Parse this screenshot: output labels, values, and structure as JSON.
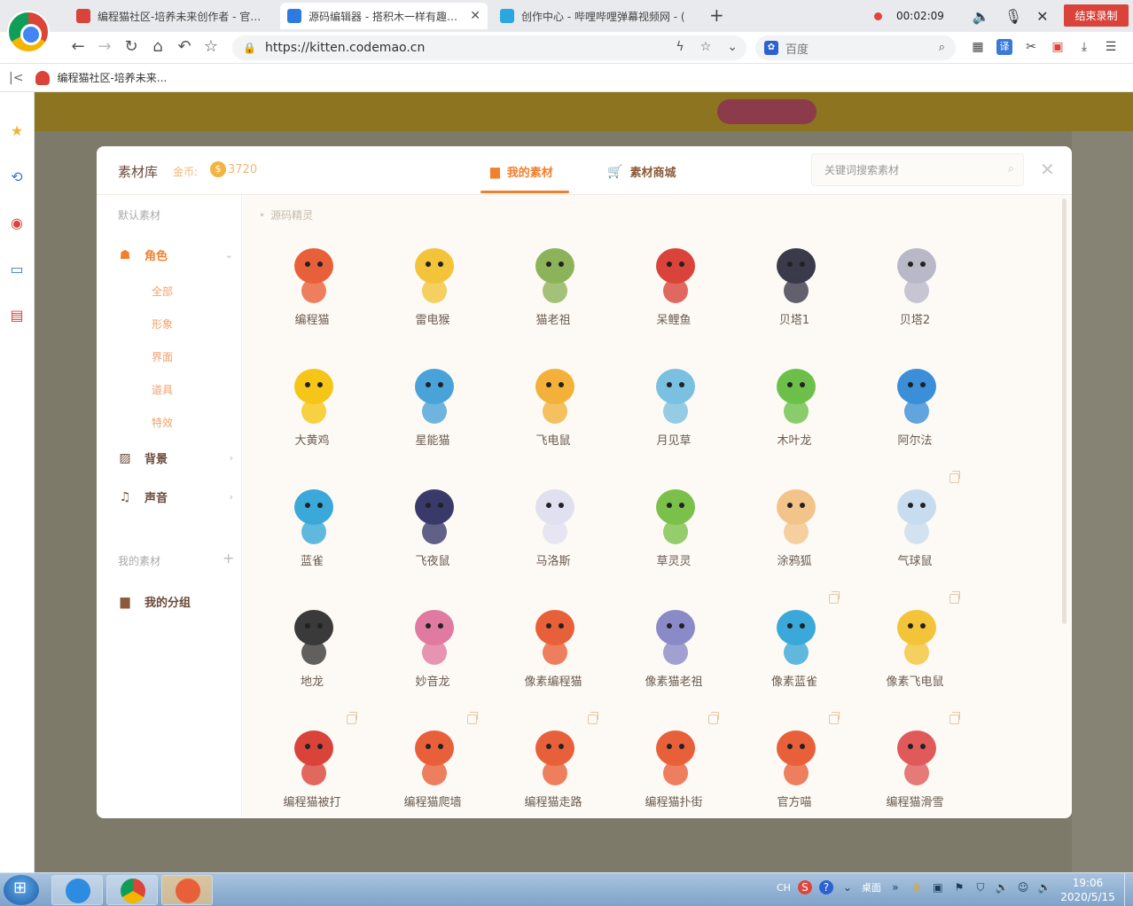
{
  "browser": {
    "tabs": [
      {
        "label": "编程猫社区-培养未来创作者 - 官方社",
        "active": false,
        "color": "#d9433a"
      },
      {
        "label": "源码编辑器 - 搭积木一样有趣的编",
        "active": true,
        "color": "#2d7be0"
      },
      {
        "label": "创作中心 - 哔哩哔哩弹幕视频网 - (",
        "active": false,
        "color": "#2aa7e0"
      }
    ],
    "new_tab": "+",
    "recording": {
      "time": "00:02:09",
      "end_label": "结束录制"
    },
    "url": "https://kitten.codemao.cn",
    "search_placeholder": "百度",
    "bookmark": "编程猫社区-培养未来..."
  },
  "modal": {
    "title": "素材库",
    "coin_label": "金币:",
    "coin_value": "3720",
    "tabs": [
      {
        "label": "我的素材",
        "icon": "folder-icon",
        "active": true
      },
      {
        "label": "素材商城",
        "icon": "cart-icon",
        "active": false
      }
    ],
    "search_placeholder": "关键词搜索素材",
    "sidebar": {
      "default_heading": "默认素材",
      "role": {
        "label": "角色",
        "sub": [
          "全部",
          "形象",
          "界面",
          "道具",
          "特效"
        ]
      },
      "background": "背景",
      "sound": "声音",
      "my_heading": "我的素材",
      "my_group": "我的分组"
    },
    "section_title": "源码精灵",
    "sprites": [
      {
        "name": "编程猫",
        "multi": false
      },
      {
        "name": "雷电猴",
        "multi": false
      },
      {
        "name": "猫老祖",
        "multi": false
      },
      {
        "name": "呆鲤鱼",
        "multi": false
      },
      {
        "name": "贝塔1",
        "multi": false
      },
      {
        "name": "贝塔2",
        "multi": false
      },
      {
        "name": "大黄鸡",
        "multi": false
      },
      {
        "name": "星能猫",
        "multi": false
      },
      {
        "name": "飞电鼠",
        "multi": false
      },
      {
        "name": "月见草",
        "multi": false
      },
      {
        "name": "木叶龙",
        "multi": false
      },
      {
        "name": "阿尔法",
        "multi": false
      },
      {
        "name": "蓝雀",
        "multi": false
      },
      {
        "name": "飞夜鼠",
        "multi": false
      },
      {
        "name": "马洛斯",
        "multi": false
      },
      {
        "name": "草灵灵",
        "multi": false
      },
      {
        "name": "涂鸦狐",
        "multi": false
      },
      {
        "name": "气球鼠",
        "multi": true
      },
      {
        "name": "地龙",
        "multi": false
      },
      {
        "name": "妙音龙",
        "multi": false
      },
      {
        "name": "像素编程猫",
        "multi": false
      },
      {
        "name": "像素猫老祖",
        "multi": false
      },
      {
        "name": "像素蓝雀",
        "multi": true
      },
      {
        "name": "像素飞电鼠",
        "multi": true
      },
      {
        "name": "编程猫被打",
        "multi": true
      },
      {
        "name": "编程猫爬墙",
        "multi": true
      },
      {
        "name": "编程猫走路",
        "multi": true
      },
      {
        "name": "编程猫扑街",
        "multi": true
      },
      {
        "name": "官方喵",
        "multi": true
      },
      {
        "name": "编程猫滑雪",
        "multi": true
      }
    ]
  },
  "taskbar": {
    "lang": "CH",
    "desktop_label": "桌面",
    "time": "19:06",
    "date": "2020/5/15"
  },
  "colors": {
    "accent": "#f37e2c",
    "brown": "#6a4a3a",
    "record": "#d9433a"
  }
}
